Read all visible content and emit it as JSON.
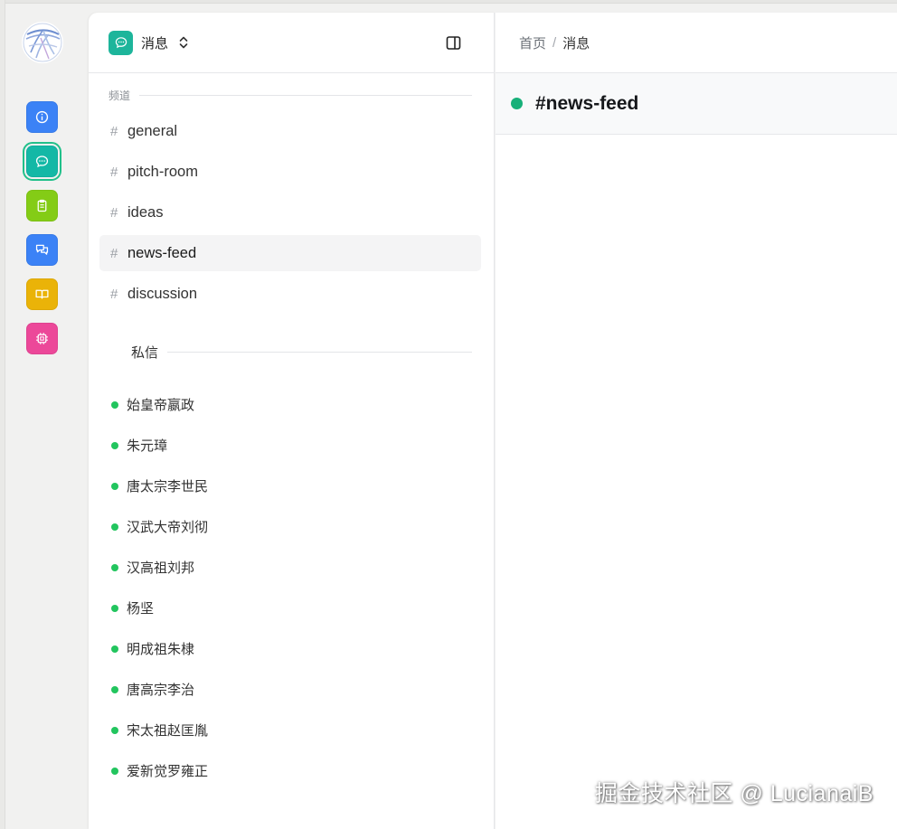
{
  "app": {
    "title": "消息"
  },
  "rail": {
    "items": [
      {
        "icon": "info-icon",
        "color": "#3b82f6"
      },
      {
        "icon": "message-icon",
        "color": "#14b8a6",
        "active": true
      },
      {
        "icon": "clipboard-icon",
        "color": "#84cc16"
      },
      {
        "icon": "chat-bubbles-icon",
        "color": "#3b82f6"
      },
      {
        "icon": "book-icon",
        "color": "#eab308"
      },
      {
        "icon": "chip-icon",
        "color": "#ec4899"
      }
    ]
  },
  "sidebar": {
    "channels_label": "频道",
    "dm_label": "私信",
    "channels": [
      {
        "hash": "#",
        "name": "general"
      },
      {
        "hash": "#",
        "name": "pitch-room"
      },
      {
        "hash": "#",
        "name": "ideas"
      },
      {
        "hash": "#",
        "name": "news-feed"
      },
      {
        "hash": "#",
        "name": "discussion"
      }
    ],
    "dms": [
      {
        "name": "始皇帝嬴政"
      },
      {
        "name": "朱元璋"
      },
      {
        "name": "唐太宗李世民"
      },
      {
        "name": "汉武大帝刘彻"
      },
      {
        "name": "汉高祖刘邦"
      },
      {
        "name": "杨坚"
      },
      {
        "name": "明成祖朱棣"
      },
      {
        "name": "唐高宗李治"
      },
      {
        "name": "宋太祖赵匡胤"
      },
      {
        "name": "爱新觉罗雍正"
      }
    ]
  },
  "breadcrumb": {
    "home": "首页",
    "separator": "/",
    "current": "消息"
  },
  "channel_header": {
    "name": "#news-feed",
    "status_color": "#17b079"
  },
  "watermark": "掘金技术社区 @ LucianaiB"
}
